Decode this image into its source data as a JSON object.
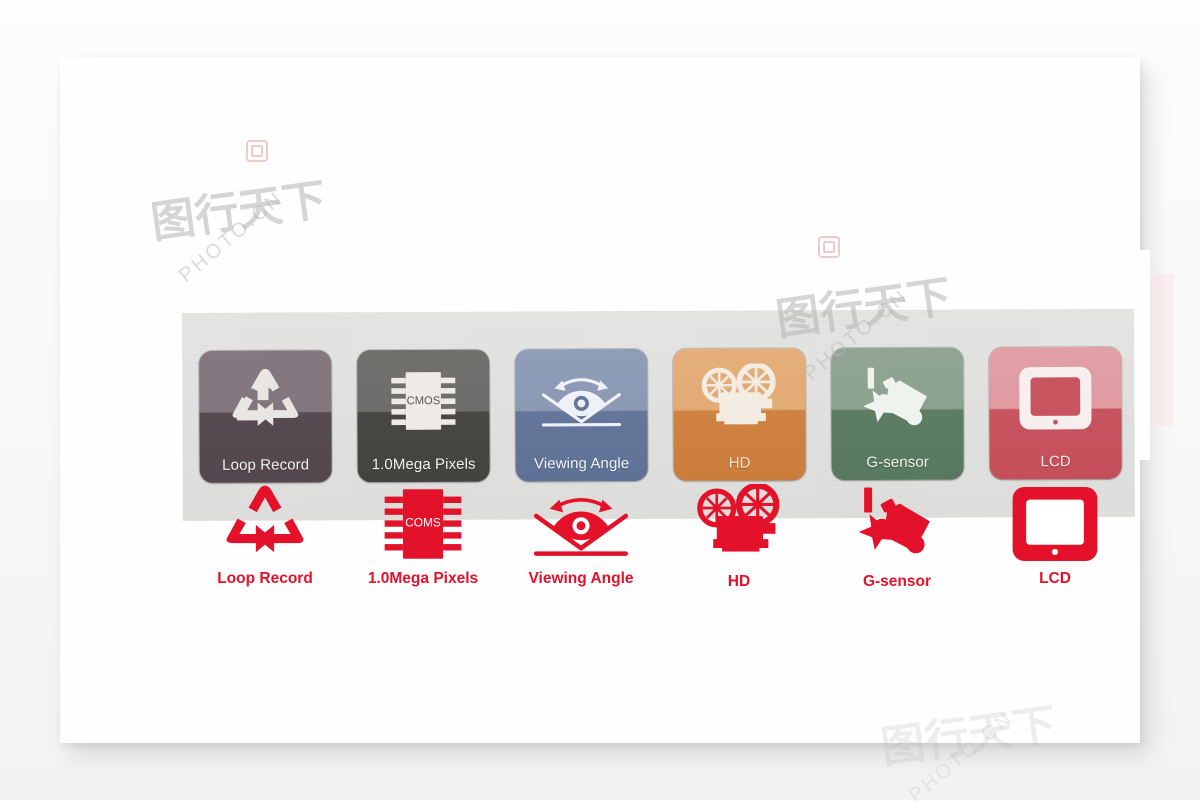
{
  "page": {
    "background_color": "#f7f7f7",
    "card_color": "#fefefe",
    "accent_red": "#e3122a"
  },
  "banner": {
    "name": "product-feature-banner",
    "background_color": "#dededc",
    "tiles": [
      {
        "id": "loop-record",
        "label": "Loop Record",
        "icon": "recycle-icon",
        "color": "#574b52",
        "label_color": "#f4f2ef"
      },
      {
        "id": "mega-pixels",
        "label": "1.0Mega Pixels",
        "icon": "chip-icon",
        "color": "#494744",
        "label_color": "#f4f2ef",
        "chip_text": "CMOS"
      },
      {
        "id": "viewing-angle",
        "label": "Viewing Angle",
        "icon": "eye-angle-icon",
        "color": "#64769a",
        "label_color": "#f2f5fa"
      },
      {
        "id": "hd",
        "label": "HD",
        "icon": "movie-camera-icon",
        "color": "#cf8241",
        "label_color": "#f6e2c9"
      },
      {
        "id": "g-sensor",
        "label": "G-sensor",
        "icon": "crash-impact-icon",
        "color": "#5d7d64",
        "label_color": "#f0f4ef"
      },
      {
        "id": "lcd",
        "label": "LCD",
        "icon": "screen-icon",
        "color": "#c8545f",
        "label_color": "#fae9ea"
      }
    ]
  },
  "red_icons": {
    "name": "red-feature-icon-row",
    "color": "#e3122a",
    "items": [
      {
        "id": "loop-record",
        "label": "Loop  Record",
        "icon": "recycle-icon"
      },
      {
        "id": "mega-pixels",
        "label": "1.0Mega Pixels",
        "icon": "chip-icon",
        "chip_text": "COMS"
      },
      {
        "id": "viewing-angle",
        "label": "Viewing Angle",
        "icon": "eye-angle-icon"
      },
      {
        "id": "hd",
        "label": "HD",
        "icon": "movie-camera-icon"
      },
      {
        "id": "g-sensor",
        "label": "G-sensor",
        "icon": "crash-impact-icon"
      },
      {
        "id": "lcd",
        "label": "LCD",
        "icon": "screen-icon"
      }
    ]
  },
  "watermarks": {
    "text": "PHOTO.CN",
    "chinese": "图行天下"
  }
}
